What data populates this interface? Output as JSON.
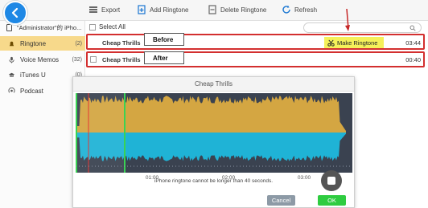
{
  "toolbar": {
    "export_label": "Export",
    "add_label": "Add Ringtone",
    "delete_label": "Delete Ringtone",
    "refresh_label": "Refresh"
  },
  "sidebar": {
    "device_label": "\"Administrator\"的 iPho...",
    "items": [
      {
        "label": "Ringtone",
        "count": "(2)"
      },
      {
        "label": "Voice Memos",
        "count": "(32)"
      },
      {
        "label": "iTunes U",
        "count": "(0)"
      },
      {
        "label": "Podcast",
        "count": ""
      }
    ]
  },
  "main": {
    "select_all": "Select All",
    "search_placeholder": "",
    "rows": [
      {
        "title": "Cheap Thrills",
        "duration": "03:44"
      },
      {
        "title": "Cheap Thrills",
        "duration": "00:40"
      }
    ],
    "annotations": {
      "before": "Before",
      "after": "After"
    },
    "make_ringtone": "Make Ringtone"
  },
  "dialog": {
    "title": "Cheap Thrills",
    "ticks": [
      "01:00",
      "02:00",
      "03:00"
    ],
    "hint": "iPhone ringtone cannot be longer than 40 seconds.",
    "cancel": "Cancel",
    "ok": "OK"
  },
  "colors": {
    "accent_blue": "#1e88e5",
    "sidebar_active": "#f7d98b",
    "wave_top": "#d4a642",
    "wave_bottom": "#1fb3d6",
    "wave_bg": "#3a4250",
    "highlight": "#f5f15a",
    "annotation_red": "#d32f2f",
    "ok_green": "#2ecc40"
  }
}
